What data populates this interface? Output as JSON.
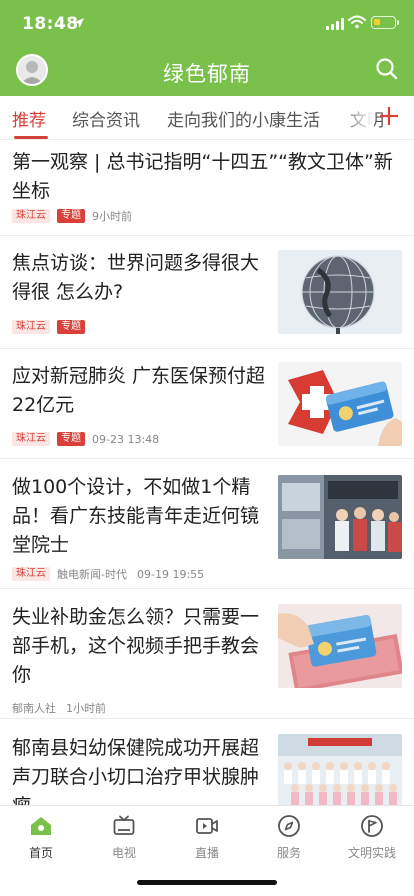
{
  "status_bar": {
    "time": "18:48"
  },
  "header": {
    "title": "绿色郁南",
    "avatar_icon": "user-avatar-icon",
    "search_icon": "search-icon"
  },
  "channel_tabs": [
    {
      "label": "推荐",
      "active": true
    },
    {
      "label": "综合资讯",
      "active": false
    },
    {
      "label": "走向我们的小康生活",
      "active": false
    },
    {
      "label": "文明",
      "active": false
    }
  ],
  "feed": [
    {
      "title": "第一观察 | 总书记指明“十四五”“教文卫体”新坐标",
      "source_badge": "珠江云",
      "topic_badge": "专题",
      "time": "9小时前"
    },
    {
      "title": "焦点访谈：世界问题多得很大得很 怎么办?",
      "source_badge": "珠江云",
      "topic_badge": "专题"
    },
    {
      "title": "应对新冠肺炎 广东医保预付超22亿元",
      "source_badge": "珠江云",
      "topic_badge": "专题",
      "time": "09-23 13:48"
    },
    {
      "title": "做100个设计，不如做1个精品！看广东技能青年走近何镜堂院士",
      "source_badge": "珠江云",
      "source": "触电新闻-时代",
      "time": "09-19 19:55"
    },
    {
      "title": "失业补助金怎么领？只需要一部手机，这个视频手把手教会你",
      "source": "郁南人社",
      "time": "1小时前"
    },
    {
      "title": "郁南县妇幼保健院成功开展超声刀联合小切口治疗甲状腺肿瘤"
    }
  ],
  "tabbar": [
    {
      "label": "首页",
      "icon": "home-icon",
      "active": true
    },
    {
      "label": "电视",
      "icon": "tv-icon",
      "active": false
    },
    {
      "label": "直播",
      "icon": "live-video-icon",
      "active": false
    },
    {
      "label": "服务",
      "icon": "compass-icon",
      "active": false
    },
    {
      "label": "文明实践",
      "icon": "flag-icon",
      "active": false
    }
  ],
  "colors": {
    "header_green": "#7ac14b",
    "accent_red": "#d9403a"
  }
}
